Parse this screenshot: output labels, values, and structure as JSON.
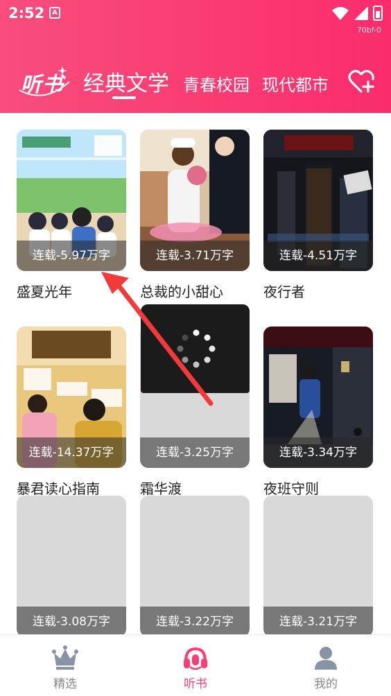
{
  "status_bar": {
    "time": "2:52",
    "notification_icon": "A",
    "badge": "70bf-0"
  },
  "header": {
    "logo": "听书",
    "tabs": [
      {
        "label": "经典文学",
        "active": true
      },
      {
        "label": "青春校园",
        "active": false
      },
      {
        "label": "现代都市",
        "active": false
      }
    ],
    "add_favorite_icon": "heart-plus-icon",
    "accent_color": "#fa3d73"
  },
  "books": [
    {
      "title": "盛夏光年",
      "status": "连载-5.97万字"
    },
    {
      "title": "总裁的小甜心",
      "status": "连载-3.71万字"
    },
    {
      "title": "夜行者",
      "status": "连载-4.51万字"
    },
    {
      "title": "暴君读心指南",
      "status": "连载-14.37万字"
    },
    {
      "title": "霜华渡",
      "status": "连载-3.25万字"
    },
    {
      "title": "夜班守则",
      "status": "连载-3.34万字"
    },
    {
      "title": "",
      "status": "连载-3.08万字"
    },
    {
      "title": "",
      "status": "连载-3.22万字"
    },
    {
      "title": "",
      "status": "连载-3.21万字"
    }
  ],
  "bottom_nav": [
    {
      "label": "精选",
      "icon": "crown-icon",
      "active": false
    },
    {
      "label": "听书",
      "icon": "headphones-icon",
      "active": true
    },
    {
      "label": "我的",
      "icon": "user-icon",
      "active": false
    }
  ]
}
